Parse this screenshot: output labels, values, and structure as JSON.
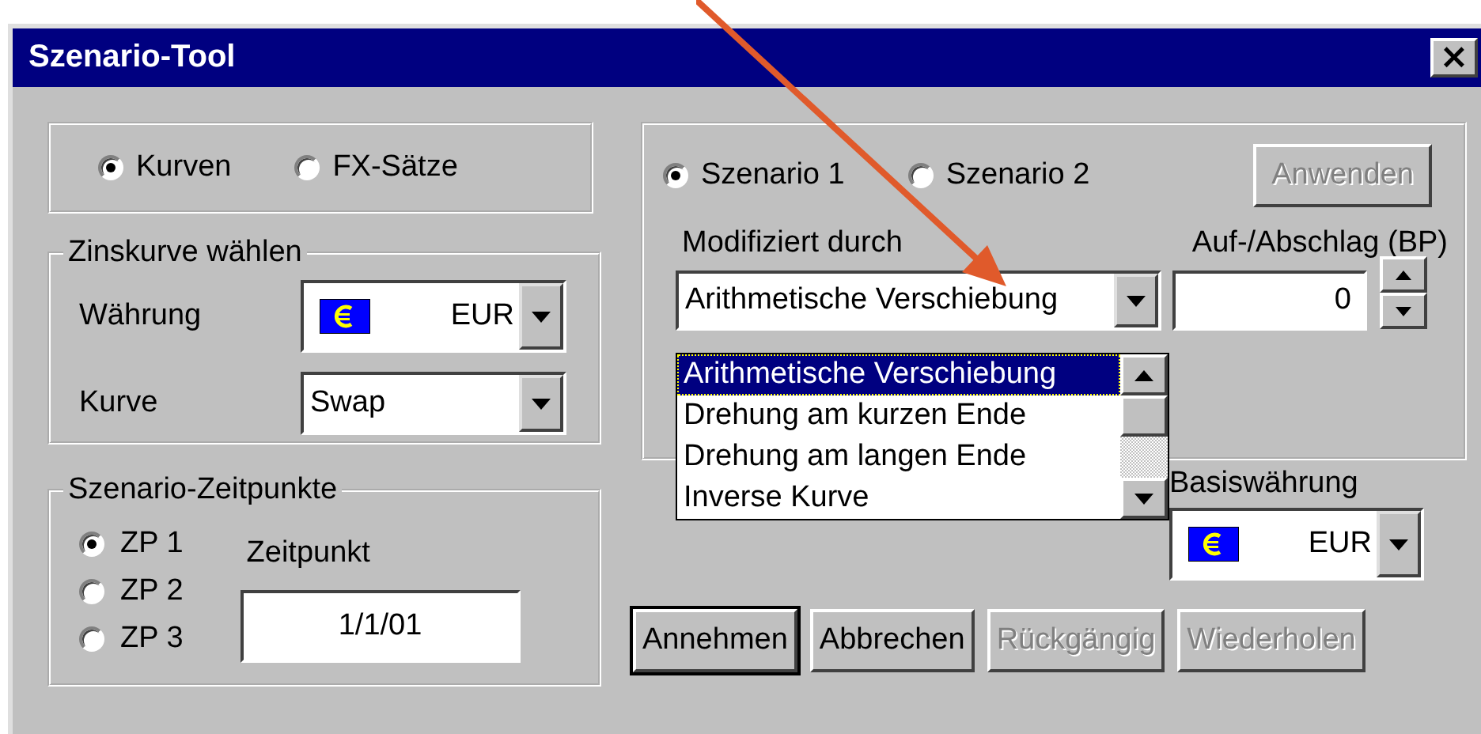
{
  "window": {
    "title": "Szenario-Tool",
    "close": "×"
  },
  "mode": [
    {
      "label": "Kurven",
      "selected": true
    },
    {
      "label": "FX-Sätze",
      "selected": false
    }
  ],
  "curve_group": {
    "title": "Zinskurve wählen",
    "currency_label": "Währung",
    "currency": "EUR",
    "curve_label": "Kurve",
    "curve": "Swap"
  },
  "timepoints": {
    "title": "Szenario-Zeitpunkte",
    "options": [
      {
        "label": "ZP 1",
        "selected": true
      },
      {
        "label": "ZP 2",
        "selected": false
      },
      {
        "label": "ZP 3",
        "selected": false
      }
    ],
    "date_label": "Zeitpunkt",
    "date": "1/1/01"
  },
  "scenario": {
    "options": [
      {
        "label": "Szenario 1",
        "selected": true
      },
      {
        "label": "Szenario 2",
        "selected": false
      }
    ],
    "apply": {
      "label": "Anwenden",
      "disabled": true
    },
    "modified_label": "Modifiziert durch",
    "modified": "Arithmetische Verschiebung",
    "shift_label": "Auf-/Abschlag (BP)",
    "shift": "0",
    "dropdown": [
      {
        "label": "Arithmetische Verschiebung",
        "selected": true
      },
      {
        "label": "Drehung am kurzen Ende",
        "selected": false
      },
      {
        "label": "Drehung am langen Ende",
        "selected": false
      },
      {
        "label": "Inverse Kurve",
        "selected": false
      }
    ]
  },
  "base_currency": {
    "label": "Basiswährung",
    "value": "EUR"
  },
  "buttons": [
    {
      "label": "Annehmen",
      "disabled": false,
      "default": true
    },
    {
      "label": "Abbrechen",
      "disabled": false,
      "default": false
    },
    {
      "label": "Rückgängig",
      "disabled": true,
      "default": false
    },
    {
      "label": "Wiederholen",
      "disabled": true,
      "default": false
    }
  ]
}
